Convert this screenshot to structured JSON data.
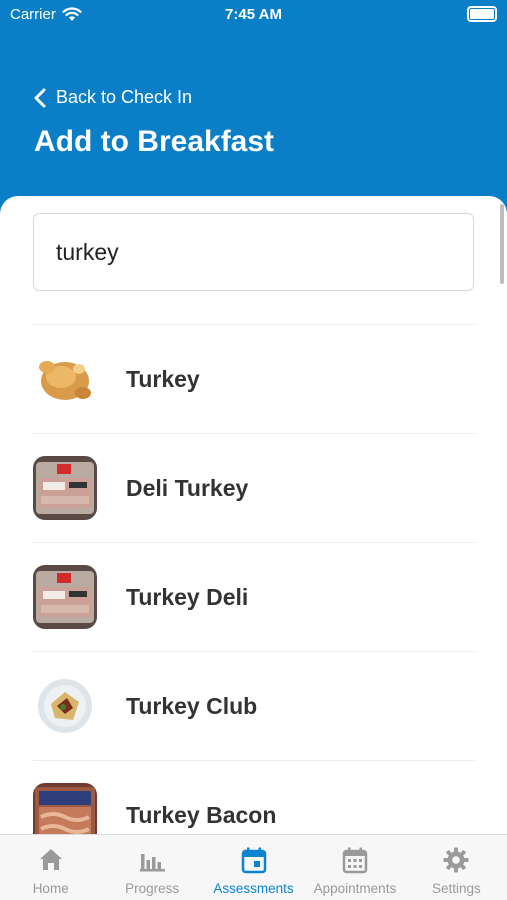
{
  "status_bar": {
    "carrier": "Carrier",
    "time": "7:45 AM",
    "battery_level": 1.0
  },
  "header": {
    "back_label": "Back to Check In",
    "title": "Add to Breakfast"
  },
  "search": {
    "value": "turkey"
  },
  "results": [
    {
      "label": "Turkey",
      "thumb": "roast-turkey"
    },
    {
      "label": "Deli Turkey",
      "thumb": "deli-package"
    },
    {
      "label": "Turkey Deli",
      "thumb": "deli-package"
    },
    {
      "label": "Turkey Club",
      "thumb": "club-sandwich"
    },
    {
      "label": "Turkey Bacon",
      "thumb": "bacon-package"
    }
  ],
  "tabs": [
    {
      "label": "Home",
      "icon": "home-icon",
      "active": false
    },
    {
      "label": "Progress",
      "icon": "bar-chart-icon",
      "active": false
    },
    {
      "label": "Assessments",
      "icon": "calendar-icon",
      "active": true
    },
    {
      "label": "Appointments",
      "icon": "calendar-grid-icon",
      "active": false
    },
    {
      "label": "Settings",
      "icon": "gear-icon",
      "active": false
    }
  ],
  "colors": {
    "brand": "#0a7fc7",
    "active_tab": "#0a84d0",
    "inactive_tab": "#9a9a9a"
  }
}
